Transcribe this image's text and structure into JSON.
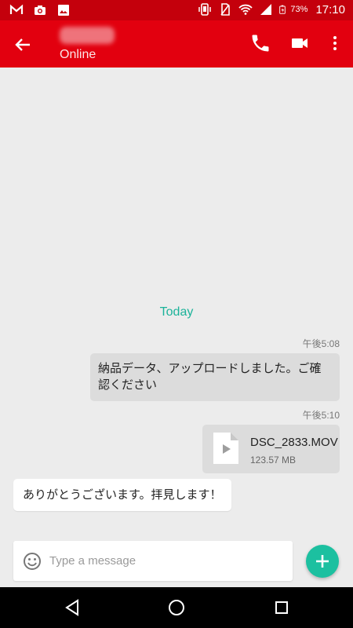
{
  "status_bar": {
    "battery_percent": "73%",
    "time": "17:10",
    "left_icons": [
      "gmail-icon",
      "camera-icon",
      "gallery-icon"
    ],
    "right_icons": [
      "vibrate-icon",
      "no-sim-icon",
      "wifi-icon",
      "signal-icon",
      "battery-icon"
    ]
  },
  "app_bar": {
    "status": "Online",
    "colors": {
      "toolbar": "#e2000f",
      "status_bar": "#c4000c"
    }
  },
  "chat": {
    "date_divider": "Today",
    "messages": [
      {
        "direction": "outgoing",
        "time": "午後5:08",
        "text": "納品データ、アップロードしました。ご確認ください"
      },
      {
        "direction": "outgoing",
        "time": "午後5:10",
        "type": "file",
        "file_name": "DSC_2833.MOV",
        "file_size": "123.57 MB"
      },
      {
        "direction": "incoming",
        "text": "ありがとうございます。拝見します！"
      }
    ],
    "accent_color": "#1cb39a"
  },
  "composer": {
    "placeholder": "Type a message",
    "value": "",
    "fab_color": "#1cc0a0"
  }
}
